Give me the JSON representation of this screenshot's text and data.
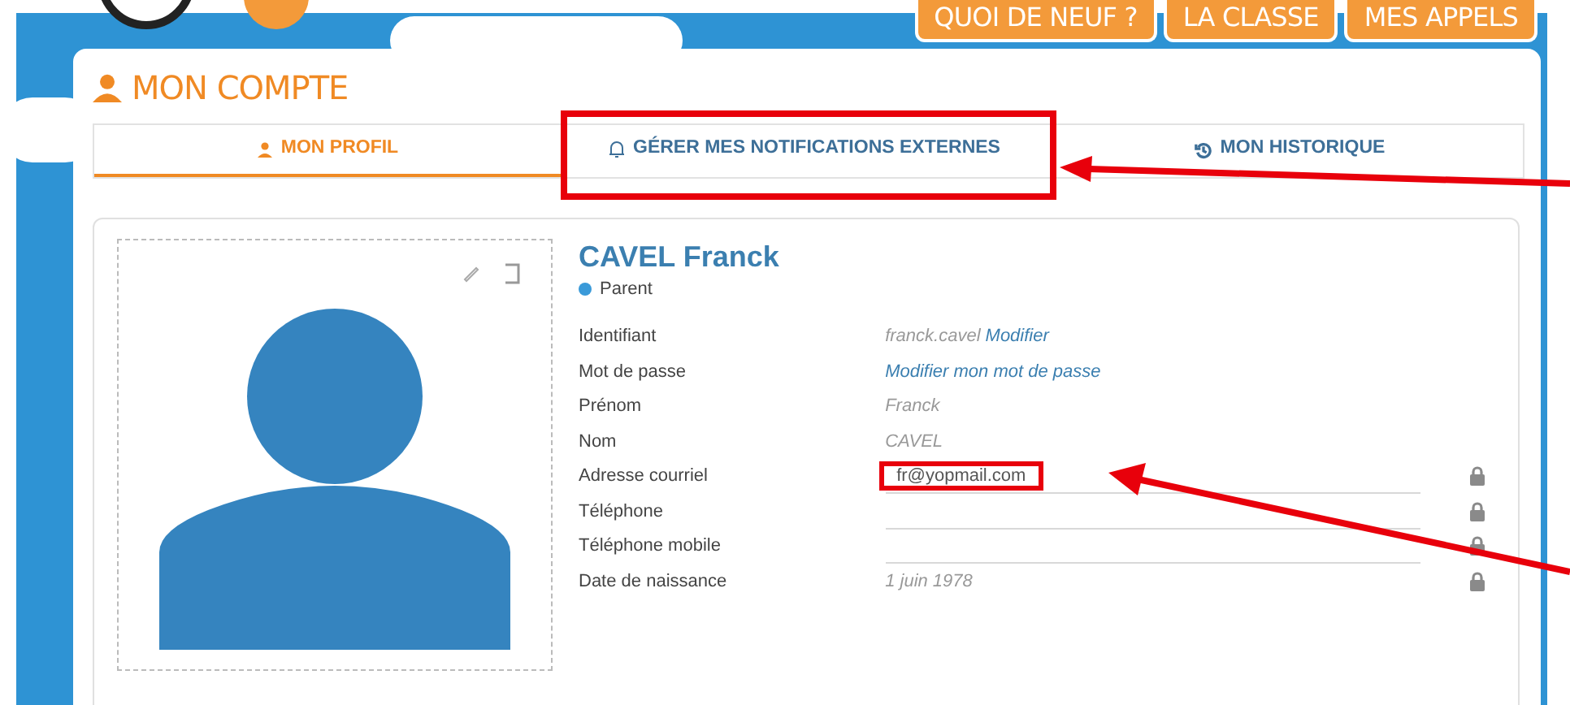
{
  "top_nav": [
    "QUOI DE NEUF ?",
    "LA CLASSE",
    "MES APPELS"
  ],
  "page_title": "MON COMPTE",
  "tabs": [
    {
      "label": "MON PROFIL",
      "selected": true,
      "highlighted": false
    },
    {
      "label": "GÉRER MES NOTIFICATIONS EXTERNES",
      "selected": false,
      "highlighted": true
    },
    {
      "label": "MON HISTORIQUE",
      "selected": false,
      "highlighted": false
    }
  ],
  "profile": {
    "name": "CAVEL Franck",
    "role": "Parent",
    "fields": [
      {
        "label": "Identifiant",
        "kind": "text",
        "value": "franck.cavel",
        "action": "Modifier",
        "locked": false,
        "highlighted": false
      },
      {
        "label": "Mot de passe",
        "kind": "link",
        "action": "Modifier mon mot de passe",
        "locked": false,
        "highlighted": false
      },
      {
        "label": "Prénom",
        "kind": "text",
        "value": "Franck",
        "locked": false,
        "highlighted": false
      },
      {
        "label": "Nom",
        "kind": "text",
        "value": "CAVEL",
        "locked": false,
        "highlighted": false
      },
      {
        "label": "Adresse courriel",
        "kind": "input",
        "value": "fr@yopmail.com",
        "locked": true,
        "highlighted": true
      },
      {
        "label": "Téléphone",
        "kind": "input",
        "locked": true,
        "highlighted": false
      },
      {
        "label": "Téléphone mobile",
        "kind": "input",
        "locked": true,
        "highlighted": false
      },
      {
        "label": "Date de naissance",
        "kind": "text",
        "value": "1 juin 1978",
        "locked": true,
        "highlighted": false
      }
    ]
  }
}
